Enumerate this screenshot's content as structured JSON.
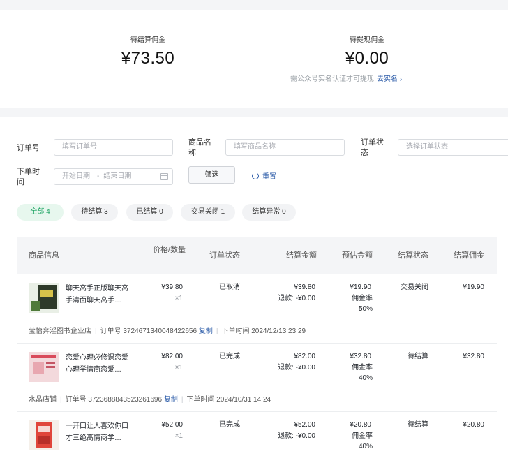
{
  "summary": {
    "pending_label": "待结算佣金",
    "pending_amount": "¥73.50",
    "withdraw_label": "待提现佣金",
    "withdraw_amount": "¥0.00",
    "note": "需公众号实名认证才可提现",
    "note_link": "去实名"
  },
  "filters": {
    "order_no_label": "订单号",
    "order_no_placeholder": "填写订单号",
    "product_label": "商品名称",
    "product_placeholder": "填写商品名称",
    "status_label": "订单状态",
    "status_placeholder": "选择订单状态",
    "time_label": "下单时间",
    "start_placeholder": "开始日期",
    "range_sep": "-",
    "end_placeholder": "结束日期",
    "filter_button": "筛选",
    "reset_button": "重置"
  },
  "tabs": [
    {
      "label": "全部 4"
    },
    {
      "label": "待结算 3"
    },
    {
      "label": "已结算 0"
    },
    {
      "label": "交易关闭 1"
    },
    {
      "label": "结算异常 0"
    }
  ],
  "table": {
    "headers": {
      "product": "商品信息",
      "price": "价格/数量",
      "order_status": "订单状态",
      "settle_amount": "结算金额",
      "est_amount": "预估金额",
      "settle_status": "结算状态",
      "commission": "结算佣金"
    },
    "rows": [
      {
        "name": "聊天高手正版聊天高手清面聊天高手…",
        "price": "¥39.80",
        "qty": "×1",
        "order_status": "已取消",
        "settle_amount": "¥39.80",
        "refund": "退款: -¥0.00",
        "est_amount": "¥19.90",
        "rate": "佣金率 50%",
        "settle_status": "交易关闭",
        "commission": "¥19.90",
        "shop": "莹怡奔淫图书企业店",
        "order_no": "订单号 3724671340048422656",
        "copy": "复制",
        "time": "下单时间 2024/12/13 23:29",
        "cover": "#2e3a2a",
        "cover_accent": "#d6c24a"
      },
      {
        "name": "恋爱心理必修课恋爱心理学情商恋爱…",
        "price": "¥82.00",
        "qty": "×1",
        "order_status": "已完成",
        "settle_amount": "¥82.00",
        "refund": "退款: -¥0.00",
        "est_amount": "¥32.80",
        "rate": "佣金率 40%",
        "settle_status": "待结算",
        "commission": "¥32.80",
        "shop": "水晶店铺",
        "order_no": "订单号 3723688843523261696",
        "copy": "复制",
        "time": "下单时间 2024/10/31 14:24",
        "cover": "#f3d9dc",
        "cover_accent": "#d94a5b"
      },
      {
        "name": "一开口让人喜欢你口才三绝高情商学…",
        "price": "¥52.00",
        "qty": "×1",
        "order_status": "已完成",
        "settle_amount": "¥52.00",
        "refund": "退款: -¥0.00",
        "est_amount": "¥20.80",
        "rate": "佣金率 40%",
        "settle_status": "待结算",
        "commission": "¥20.80",
        "cover": "#f5f0ea",
        "cover_accent": "#e0463b"
      }
    ]
  }
}
